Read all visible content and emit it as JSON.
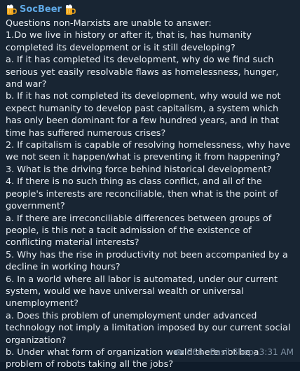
{
  "message": {
    "sender": "SocBeer",
    "sender_icons": [
      "beer-mug-icon",
      "beer-mug-icon"
    ],
    "text": "Questions non-Marxists are unable to answer:\n1.Do we live in history or after it, that is, has humanity completed its development or is it still developing?\na. If it has completed its development, why do we find such serious yet easily resolvable flaws as homelessness, hunger, and war?\nb. If it has not completed its development, why would we not expect humanity to develop past capitalism, a system which has only been dominant for a few hundred years, and in that time has suffered numerous crises?\n2. If capitalism is capable of resolving homelessness, why have we not seen it happen/what is preventing it from happening?\n3. What is the driving force behind historical development?\n4. If there is no such thing as class conflict, and all of the people's interests are reconciliable, then what is the point of government?\na. If there are irreconciliable differences between groups of people, is this not a tacit admission of the existence of conflicting material interests?\n5. Why has the rise in productivity not been accompanied by a decline in working hours?\n6. In a world where all labor is automated, under our current system, would we have universal wealth or universal unemployment?\na. Does this problem of unemployment under advanced technology not imply a limitation imposed by our current social organization?\nb. Under what form of organization would there not be a problem of robots taking all the jobs?",
    "views": "664",
    "author": "Basil Shep",
    "time": "3:31 AM",
    "signature": "Basil Shep, 3:31 AM"
  },
  "colors": {
    "bubble_bg": "#182533",
    "sender_name": "#5fa9e6",
    "text": "#e9eef3",
    "meta": "#7f91a3"
  }
}
